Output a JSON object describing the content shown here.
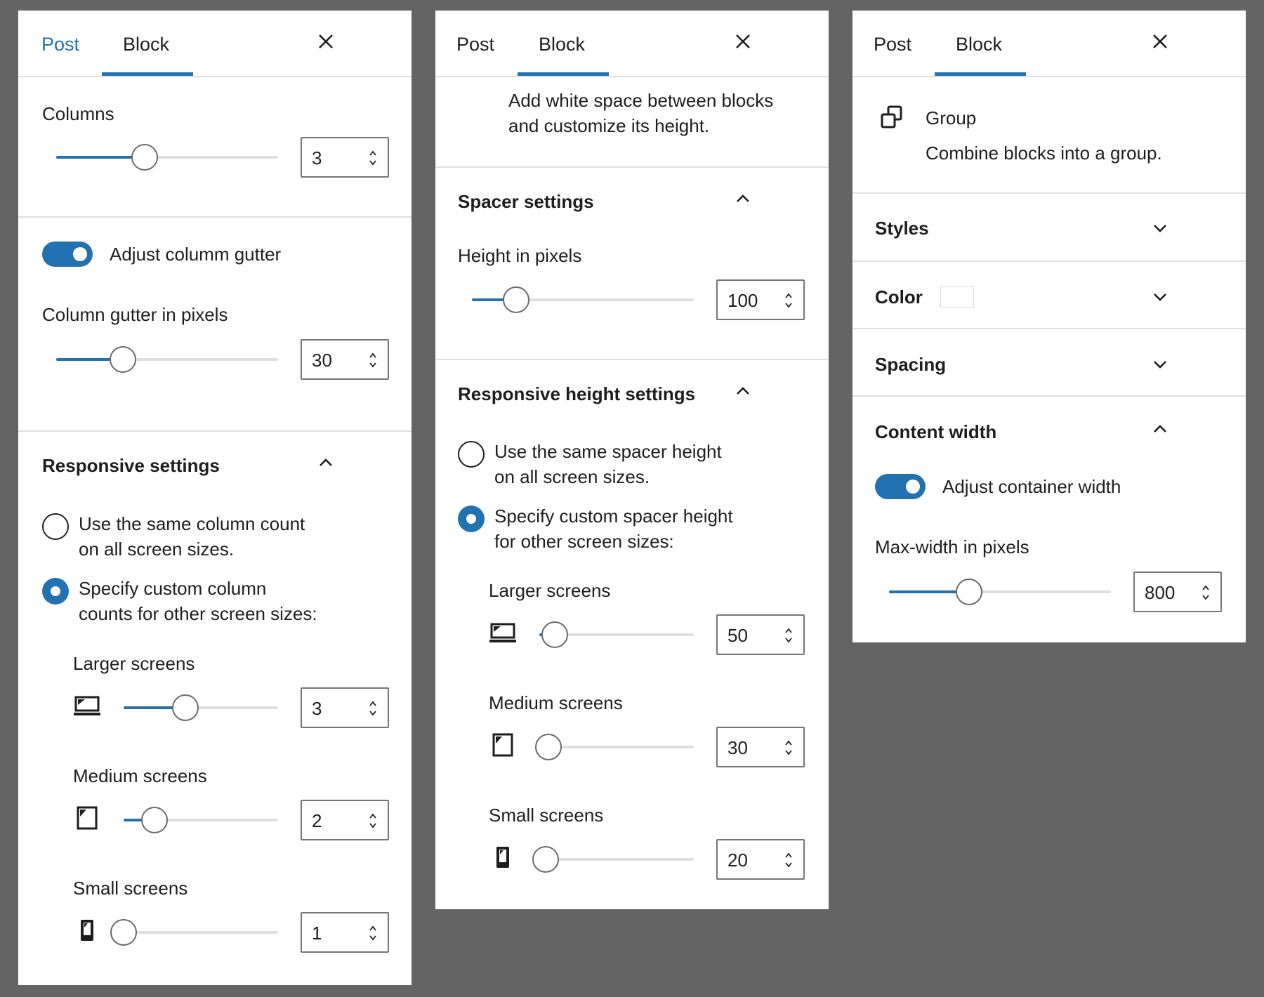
{
  "panel_columns": {
    "tabs": {
      "post": "Post",
      "block": "Block"
    },
    "columns_label": "Columns",
    "columns_value": "3",
    "columns_level": 0.4,
    "gutter_toggle_label": "Adjust columm gutter",
    "gutter_label": "Column gutter in pixels",
    "gutter_value": "30",
    "gutter_level": 0.3,
    "responsive_title": "Responsive settings",
    "radio_same_line1": "Use the same column count",
    "radio_same_line2": "on all screen sizes.",
    "radio_custom_line1": "Specify custom column",
    "radio_custom_line2": "counts for other screen sizes:",
    "larger_label": "Larger screens",
    "larger_value": "3",
    "larger_level": 0.4,
    "medium_label": "Medium screens",
    "medium_value": "2",
    "medium_level": 0.2,
    "small_label": "Small screens",
    "small_value": "1",
    "small_level": 0.0
  },
  "panel_spacer": {
    "tabs": {
      "post": "Post",
      "block": "Block"
    },
    "desc_line1": "Add white space between blocks",
    "desc_line2": "and customize its height.",
    "spacer_title": "Spacer settings",
    "height_label": "Height in pixels",
    "height_value": "100",
    "height_level": 0.2,
    "responsive_title": "Responsive height settings",
    "radio_same_line1": "Use the same spacer height",
    "radio_same_line2": "on all screen sizes.",
    "radio_custom_line1": "Specify custom spacer height",
    "radio_custom_line2": "for other screen sizes:",
    "larger_label": "Larger screens",
    "larger_value": "50",
    "larger_level": 0.1,
    "medium_label": "Medium screens",
    "medium_value": "30",
    "medium_level": 0.06,
    "small_label": "Small screens",
    "small_value": "20",
    "small_level": 0.04
  },
  "panel_group": {
    "tabs": {
      "post": "Post",
      "block": "Block"
    },
    "block_name": "Group",
    "block_desc": "Combine blocks into a group.",
    "styles_label": "Styles",
    "color_label": "Color",
    "spacing_label": "Spacing",
    "content_width_title": "Content width",
    "container_toggle_label": "Adjust container width",
    "maxwidth_label": "Max-width in pixels",
    "maxwidth_value": "800",
    "maxwidth_level": 0.36
  },
  "colors": {
    "accent": "#2271b1",
    "background": "#646464",
    "panel": "#ffffff"
  },
  "icons": [
    "close-icon",
    "chevron-up-icon",
    "chevron-down-icon",
    "spin-arrows-icon",
    "laptop-icon",
    "tablet-icon",
    "phone-icon",
    "group-block-icon"
  ]
}
